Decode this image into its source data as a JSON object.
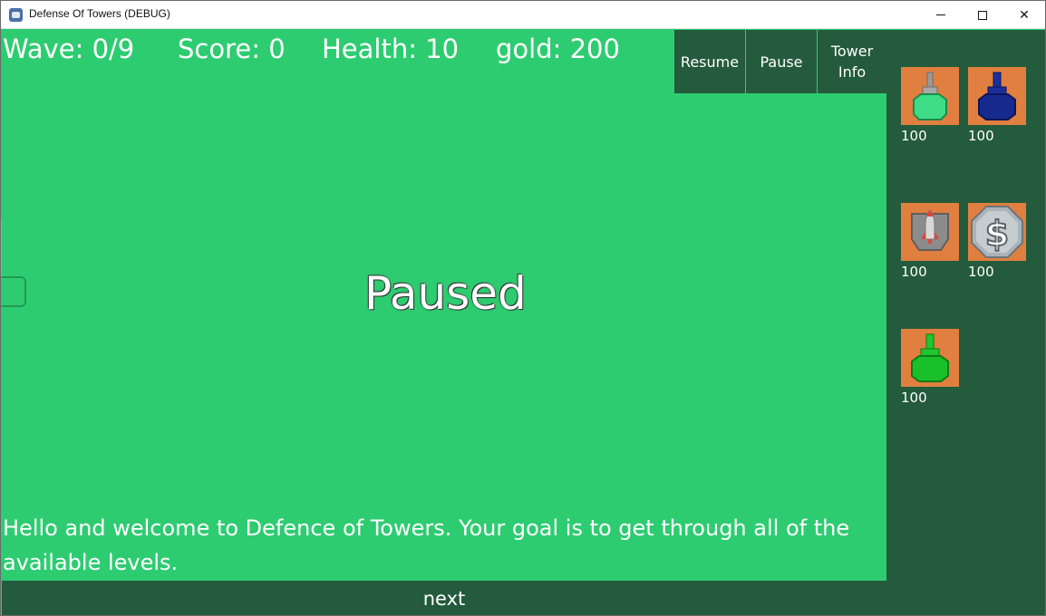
{
  "window": {
    "title": "Defense Of Towers (DEBUG)"
  },
  "hud": {
    "wave": "Wave: 0/9",
    "score": "Score: 0",
    "health": "Health: 10",
    "gold": "gold: 200"
  },
  "controls": {
    "resume_label": "Resume",
    "pause_label": "Pause",
    "tower_info_label_line1": "Tower",
    "tower_info_label_line2": "Info"
  },
  "overlay": {
    "paused_text": "Paused"
  },
  "tutorial": {
    "message": "Hello and welcome to Defence of Towers. Your goal is to get through all of the available levels.",
    "next_label": "next"
  },
  "shop": {
    "towers": [
      {
        "icon": "gun-turret-green-icon",
        "price": "100"
      },
      {
        "icon": "gun-turret-blue-icon",
        "price": "100"
      },
      {
        "icon": "missile-launcher-icon",
        "price": "100"
      },
      {
        "icon": "money-generator-icon",
        "price": "100"
      },
      {
        "icon": "gun-turret-bright-green-icon",
        "price": "100"
      }
    ]
  },
  "colors": {
    "grass": "#2ecc71",
    "panel": "#245b3c",
    "path": "#b97942",
    "tower_slot": "#e07f3f"
  }
}
